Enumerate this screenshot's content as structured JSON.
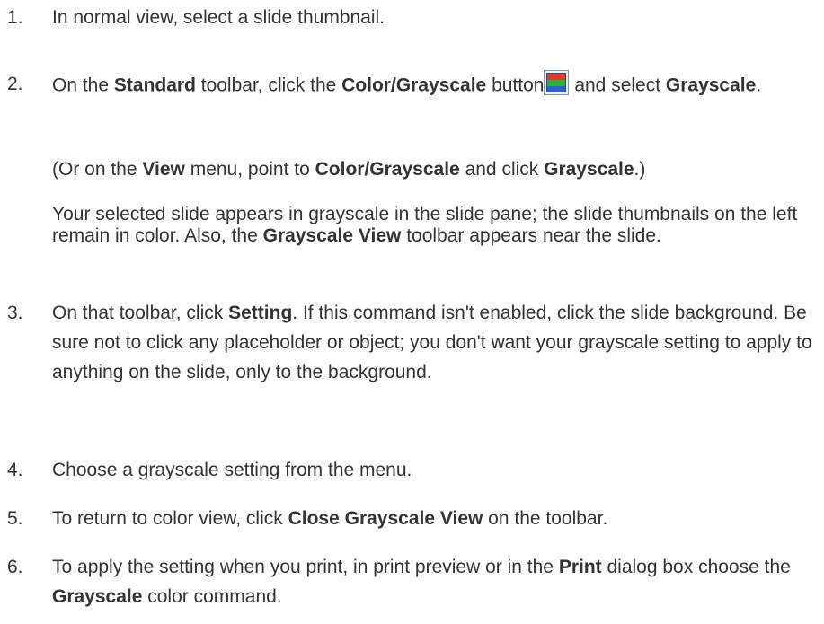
{
  "steps": [
    {
      "num": "1.",
      "parts": [
        "In normal view, select a slide thumbnail."
      ]
    },
    {
      "num": "2.",
      "parts": [
        "On the ",
        "Standard",
        " toolbar, click the ",
        "Color/Grayscale",
        " button",
        " and select ",
        "Grayscale",
        "."
      ],
      "icon": "color-grayscale-icon"
    },
    {
      "num": "3.",
      "parts": [
        "On that toolbar, click ",
        "Setting",
        ". If this command isn't enabled, click the slide background. Be sure not to click any placeholder or object; you don't want your grayscale setting to apply to anything on the slide, only to the background."
      ]
    },
    {
      "num": "4.",
      "parts": [
        "Choose a grayscale setting from the menu."
      ]
    },
    {
      "num": "5.",
      "parts": [
        "To return to color view, click ",
        "Close Grayscale View",
        " on the toolbar."
      ]
    },
    {
      "num": "6.",
      "parts": [
        "To apply the setting when you print, in print preview or in the ",
        "Print",
        " dialog box choose the ",
        "Grayscale",
        " color command."
      ]
    }
  ],
  "note_view_menu": [
    "(Or on the ",
    "View",
    " menu, point to ",
    "Color/Grayscale",
    " and click ",
    "Grayscale",
    ".)"
  ],
  "note_result": [
    "Your selected slide appears in grayscale in the slide pane; the slide thumbnails on the left remain in color. Also, the ",
    "Grayscale View",
    " toolbar appears near the slide."
  ]
}
